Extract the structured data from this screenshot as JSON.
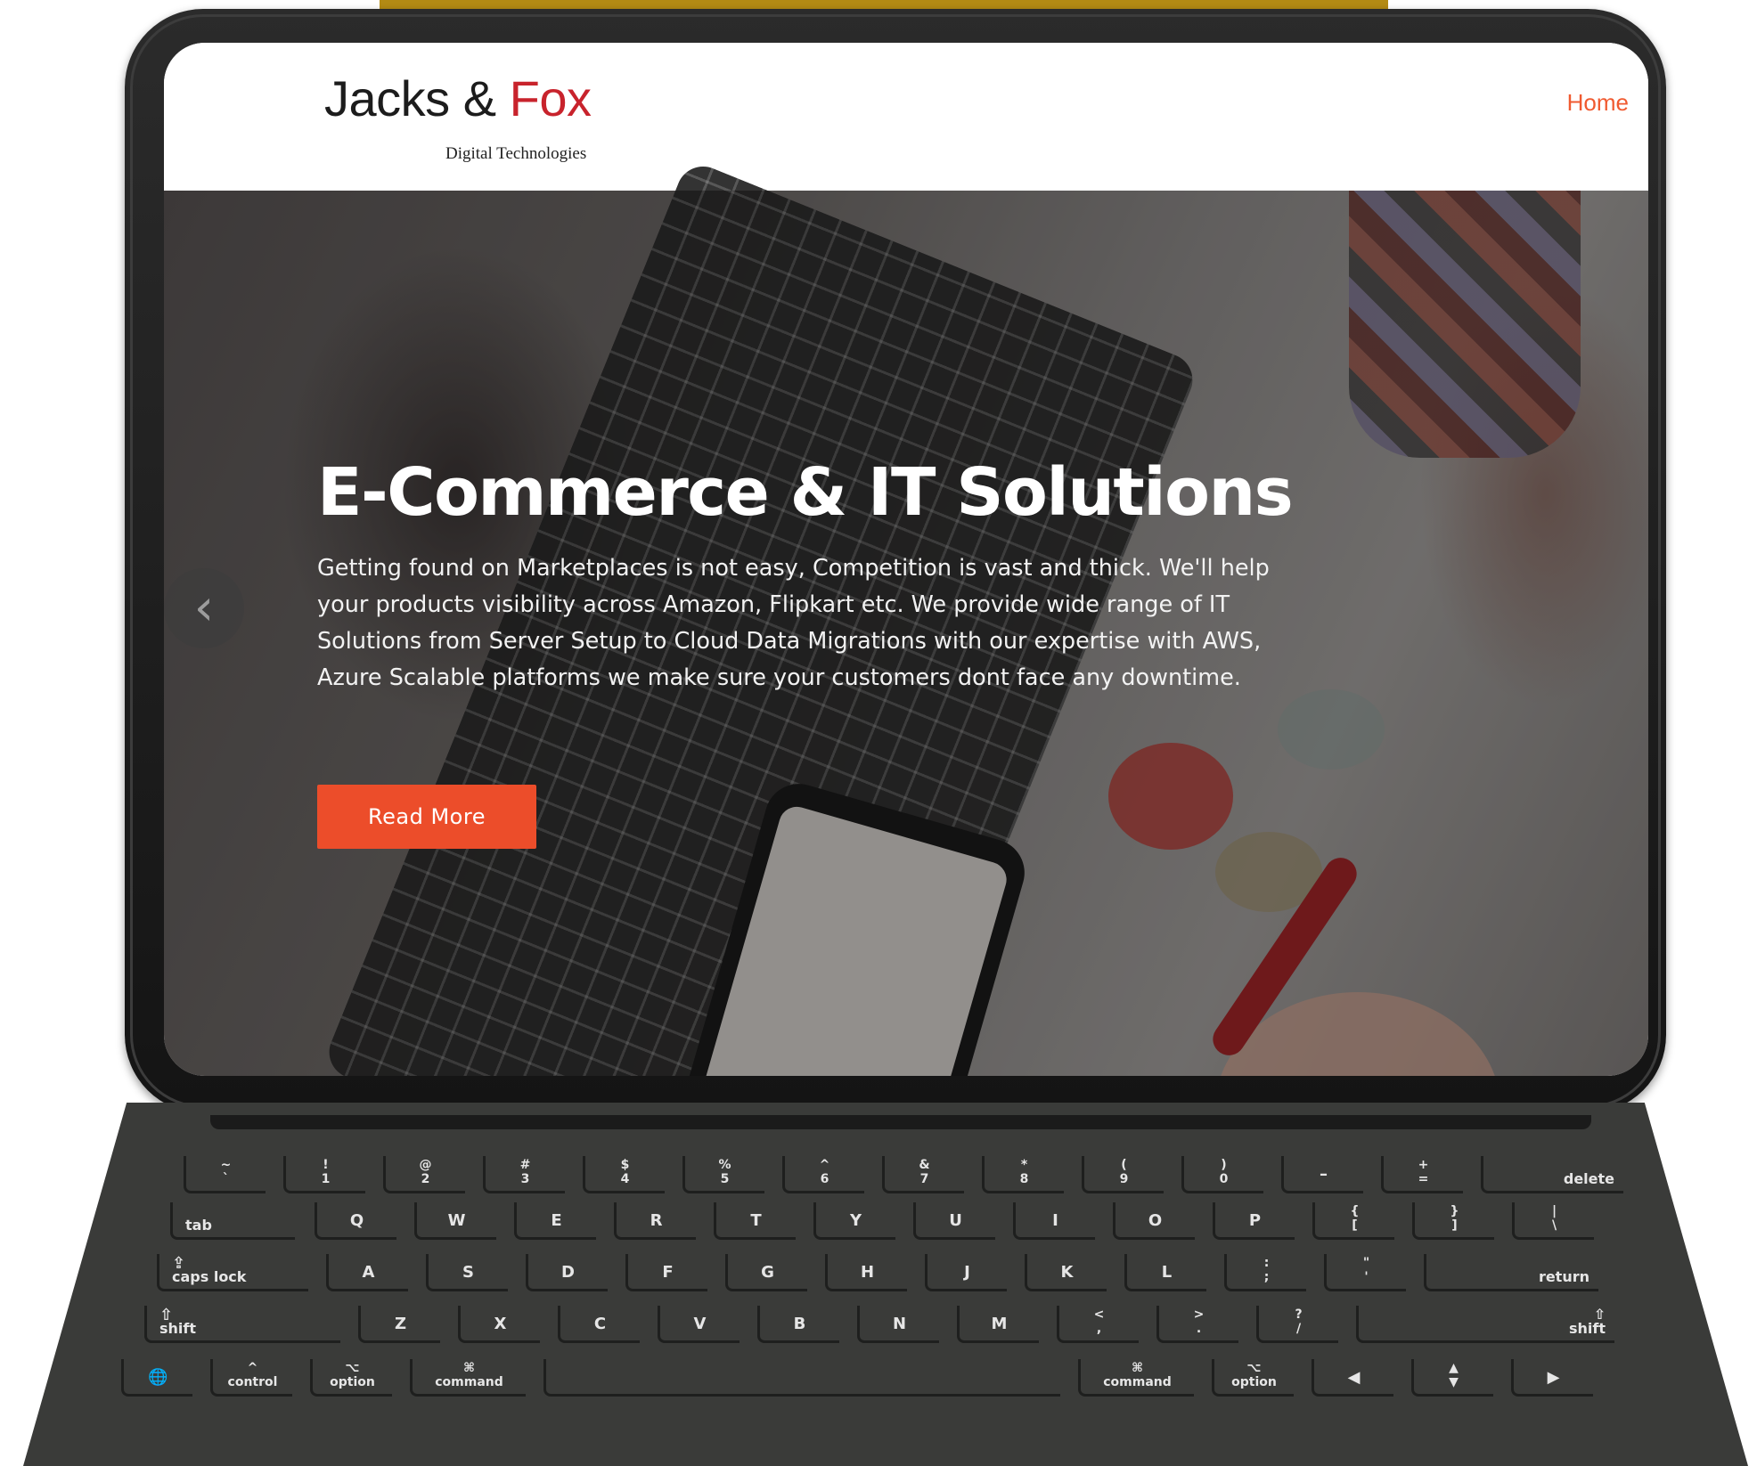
{
  "site": {
    "logo": {
      "part1": "Jacks & ",
      "part2": "Fox",
      "tagline": "Digital Technologies"
    },
    "nav": {
      "home": "Home"
    },
    "hero": {
      "title": "E-Commerce & IT Solutions",
      "text": "Getting found on Marketplaces is not easy, Competition is vast and thick. We'll help your products visibility across Amazon, Flipkart etc. We provide wide range of IT Solutions from Server Setup to Cloud Data Migrations with our expertise with AWS, Azure Scalable platforms we make sure your customers dont face any downtime.",
      "button": "Read More",
      "prev_glyph": "‹"
    }
  },
  "keyboard": {
    "row1": [
      {
        "top": "~",
        "bot": "`"
      },
      {
        "top": "!",
        "bot": "1"
      },
      {
        "top": "@",
        "bot": "2"
      },
      {
        "top": "#",
        "bot": "3"
      },
      {
        "top": "$",
        "bot": "4"
      },
      {
        "top": "%",
        "bot": "5"
      },
      {
        "top": "^",
        "bot": "6"
      },
      {
        "top": "&",
        "bot": "7"
      },
      {
        "top": "*",
        "bot": "8"
      },
      {
        "top": "(",
        "bot": "9"
      },
      {
        "top": ")",
        "bot": "0"
      },
      {
        "top": "–",
        "bot": ""
      },
      {
        "top": "+",
        "bot": "="
      }
    ],
    "delete": "delete",
    "tab": "tab",
    "row2": [
      "Q",
      "W",
      "E",
      "R",
      "T",
      "Y",
      "U",
      "I",
      "O",
      "P"
    ],
    "row2_extra": [
      {
        "top": "{",
        "bot": "["
      },
      {
        "top": "}",
        "bot": "]"
      },
      {
        "top": "|",
        "bot": "\\"
      }
    ],
    "caps": {
      "icon": "⇪",
      "label": "caps lock"
    },
    "row3": [
      "A",
      "S",
      "D",
      "F",
      "G",
      "H",
      "J",
      "K",
      "L"
    ],
    "row3_extra": [
      {
        "top": ":",
        "bot": ";"
      },
      {
        "top": "\"",
        "bot": "'"
      }
    ],
    "return": "return",
    "shift_left": {
      "icon": "⇧",
      "label": "shift"
    },
    "row4": [
      "Z",
      "X",
      "C",
      "V",
      "B",
      "N",
      "M"
    ],
    "row4_extra": [
      {
        "top": "<",
        "bot": ","
      },
      {
        "top": ">",
        "bot": "."
      },
      {
        "top": "?",
        "bot": "/"
      }
    ],
    "shift_right": {
      "icon": "⇧",
      "label": "shift"
    },
    "globe": "🌐",
    "control": {
      "icon": "^",
      "label": "control"
    },
    "option_left": {
      "icon": "⌥",
      "label": "option"
    },
    "command_left": {
      "icon": "⌘",
      "label": "command"
    },
    "command_right": {
      "icon": "⌘",
      "label": "command"
    },
    "option_right": {
      "icon": "⌥",
      "label": "option"
    },
    "arrows": {
      "left": "◀",
      "up": "▲",
      "down": "▼",
      "right": "▶"
    }
  },
  "colors": {
    "accent": "#ec4d2a",
    "brand_red": "#c8232c",
    "nav": "#f05a30",
    "gold": "#b38a14"
  }
}
